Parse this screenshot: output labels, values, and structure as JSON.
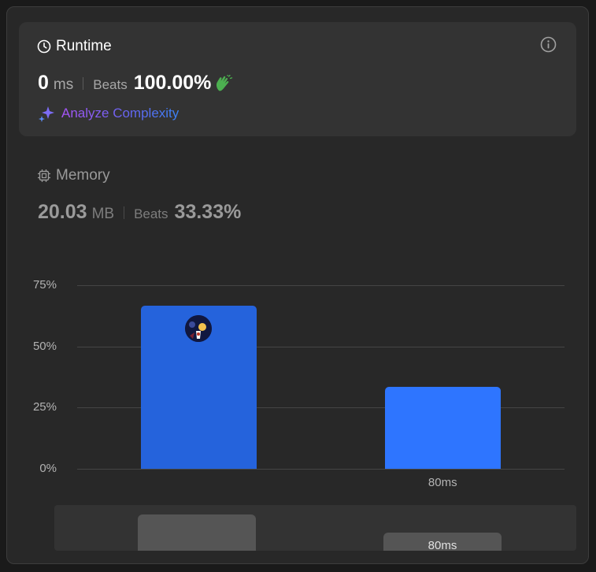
{
  "runtime": {
    "title": "Runtime",
    "value": "0",
    "unit": "ms",
    "beats_label": "Beats",
    "beats_value": "100.00%",
    "analyze_label": "Analyze Complexity"
  },
  "memory": {
    "title": "Memory",
    "value": "20.03",
    "unit": "MB",
    "beats_label": "Beats",
    "beats_value": "33.33%"
  },
  "chart_data": {
    "type": "bar",
    "categories": [
      "",
      "80ms"
    ],
    "values": [
      66.67,
      33.33
    ],
    "ylim": [
      0,
      75
    ],
    "yticks": [
      "75%",
      "50%",
      "25%",
      "0%"
    ],
    "ytick_values": [
      75,
      50,
      25,
      0
    ],
    "grid": true,
    "highlighted_index": 0,
    "colors": {
      "highlighted": "#2563dc",
      "default": "#2e75ff"
    }
  },
  "scroller": {
    "label": "80ms",
    "values": [
      66.67,
      33.33
    ]
  },
  "colors": {
    "runtime_beats_icon": "#4caf50",
    "memory_text": "#9a9a9a",
    "analyze_gradient": [
      "#a855f7",
      "#3b82f6"
    ]
  }
}
